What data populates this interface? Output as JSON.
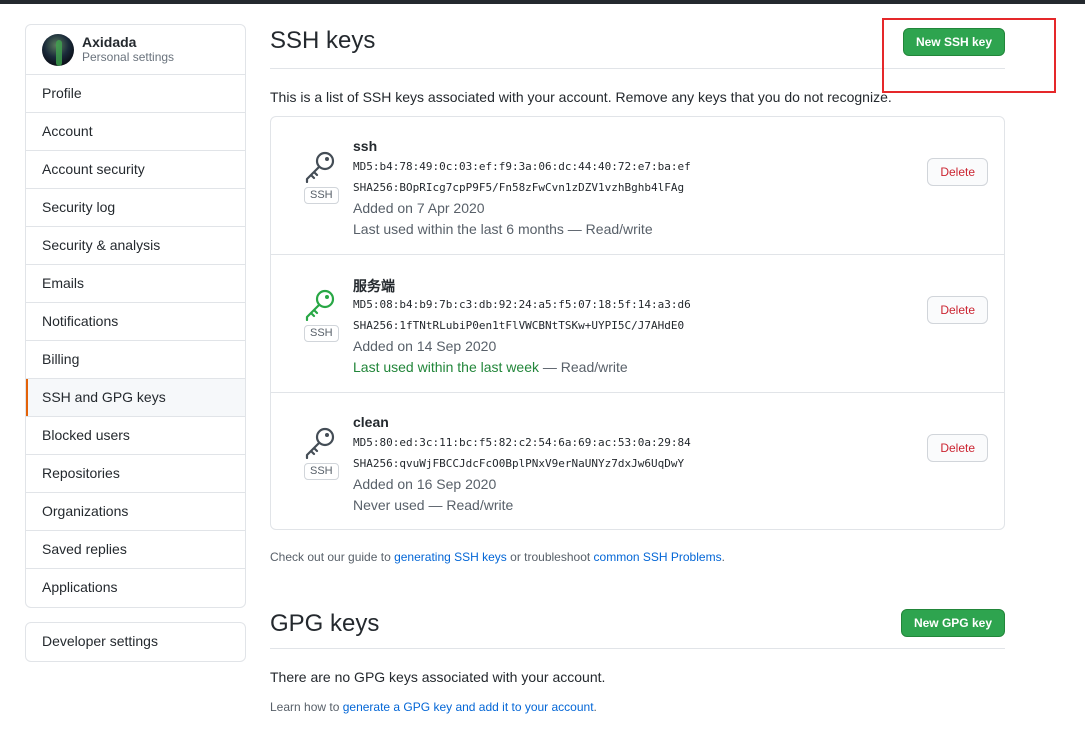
{
  "user": {
    "name": "Axidada",
    "subtitle": "Personal settings"
  },
  "sidebar": {
    "items": [
      {
        "label": "Profile"
      },
      {
        "label": "Account"
      },
      {
        "label": "Account security"
      },
      {
        "label": "Security log"
      },
      {
        "label": "Security & analysis"
      },
      {
        "label": "Emails"
      },
      {
        "label": "Notifications"
      },
      {
        "label": "Billing"
      },
      {
        "label": "SSH and GPG keys"
      },
      {
        "label": "Blocked users"
      },
      {
        "label": "Repositories"
      },
      {
        "label": "Organizations"
      },
      {
        "label": "Saved replies"
      },
      {
        "label": "Applications"
      }
    ],
    "selected": "SSH and GPG keys",
    "developer_settings": "Developer settings"
  },
  "ssh": {
    "title": "SSH keys",
    "new_button": "New SSH key",
    "intro": "This is a list of SSH keys associated with your account. Remove any keys that you do not recognize.",
    "badge": "SSH",
    "delete_label": "Delete",
    "keys": [
      {
        "name": "ssh",
        "md5": "MD5:b4:78:49:0c:03:ef:f9:3a:06:dc:44:40:72:e7:ba:ef",
        "sha256": "SHA256:BOpRIcg7cpP9F5/Fn58zFwCvn1zDZV1vzhBghb4lFAg",
        "added": "Added on 7 Apr 2020",
        "last_used": "Last used within the last 6 months",
        "access": " — Read/write",
        "icon_color": "#444d56"
      },
      {
        "name": "服务端",
        "md5": "MD5:08:b4:b9:7b:c3:db:92:24:a5:f5:07:18:5f:14:a3:d6",
        "sha256": "SHA256:1fTNtRLubiP0en1tFlVWCBNtTSKw+UYPI5C/J7AHdE0",
        "added": "Added on 14 Sep 2020",
        "last_used": "Last used within the last week",
        "access": " — Read/write",
        "icon_color": "#28a745"
      },
      {
        "name": "clean",
        "md5": "MD5:80:ed:3c:11:bc:f5:82:c2:54:6a:69:ac:53:0a:29:84",
        "sha256": "SHA256:qvuWjFBCCJdcFcO0BplPNxV9erNaUNYz7dxJw6UqDwY",
        "added": "Added on 16 Sep 2020",
        "last_used": "Never used",
        "access": " — Read/write",
        "icon_color": "#444d56"
      }
    ],
    "guide": {
      "prefix": "Check out our guide to ",
      "link1": "generating SSH keys",
      "middle": " or troubleshoot ",
      "link2": "common SSH Problems",
      "suffix": "."
    }
  },
  "gpg": {
    "title": "GPG keys",
    "new_button": "New GPG key",
    "empty": "There are no GPG keys associated with your account.",
    "learn": {
      "prefix": "Learn how to ",
      "link": "generate a GPG key and add it to your account",
      "suffix": "."
    }
  }
}
